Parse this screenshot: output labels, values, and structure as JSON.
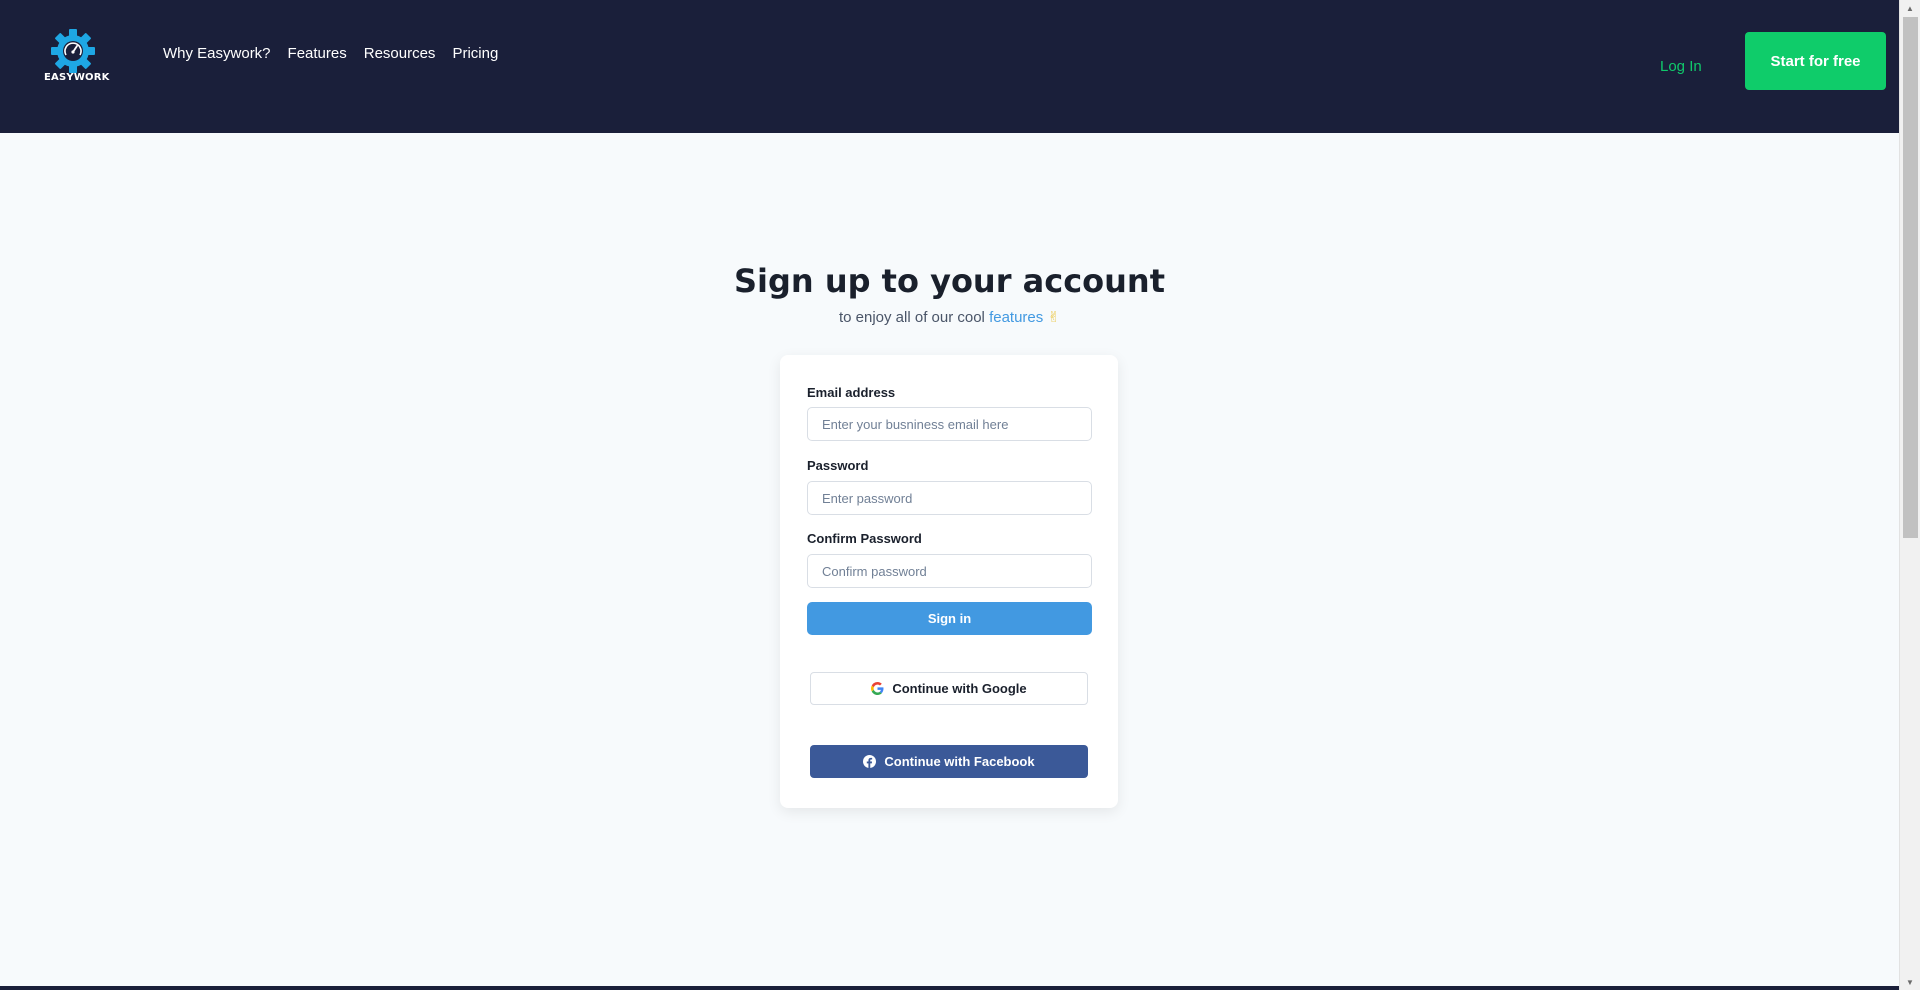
{
  "header": {
    "logo_text": "EASYWORK",
    "nav": [
      {
        "label": "Why Easywork?"
      },
      {
        "label": "Features"
      },
      {
        "label": "Resources"
      },
      {
        "label": "Pricing"
      }
    ],
    "login_label": "Log In",
    "start_label": "Start for free"
  },
  "hero": {
    "title": "Sign up to your account",
    "subtitle_prefix": "to enjoy all of our cool ",
    "subtitle_link": "features",
    "subtitle_emoji": "✌"
  },
  "form": {
    "email_label": "Email address",
    "email_placeholder": "Enter your busniness email here",
    "password_label": "Password",
    "password_placeholder": "Enter password",
    "confirm_label": "Confirm Password",
    "confirm_placeholder": "Confirm password",
    "signin_label": "Sign in",
    "google_label": "Continue with Google",
    "facebook_label": "Continue with Facebook"
  },
  "colors": {
    "header_bg": "#1a1f3a",
    "accent_green": "#0fcc6a",
    "primary_blue": "#4299e1",
    "facebook_blue": "#3b5998",
    "page_bg": "#f7fafc"
  },
  "icons": {
    "logo": "gear-speedometer-icon",
    "google": "google-g-icon",
    "facebook": "facebook-f-icon",
    "scroll_up": "arrow-up-icon",
    "scroll_down": "arrow-down-icon"
  }
}
